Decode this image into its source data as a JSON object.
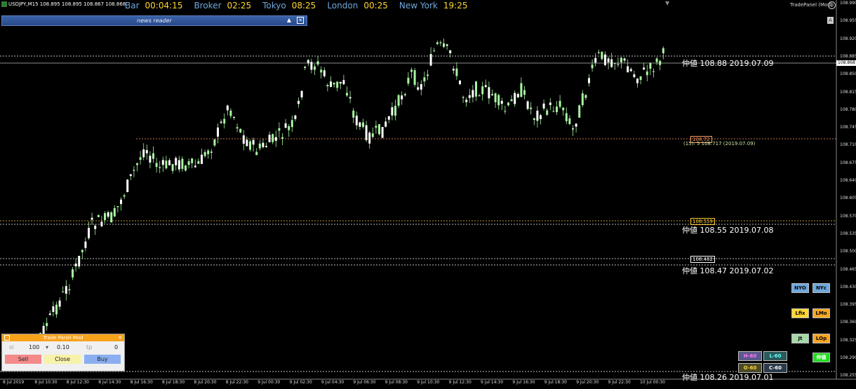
{
  "header": {
    "symbol_info": "USDJPY,M15  108.895 108.895 108.867 108.868",
    "sessions": [
      {
        "name": "Bar",
        "time": "00:04:15"
      },
      {
        "name": "Broker",
        "time": "02:25"
      },
      {
        "name": "Tokyo",
        "time": "08:25"
      },
      {
        "name": "London",
        "time": "00:25"
      },
      {
        "name": "New York",
        "time": "19:25"
      }
    ],
    "trade_panel_name": "TradePanel (Mod)",
    "a_label": "A"
  },
  "news_reader": {
    "title": "news reader",
    "collapse": "▲",
    "close": "✕"
  },
  "price_axis": {
    "labels": [
      "108.990",
      "108.955",
      "108.920",
      "108.885",
      "108.850",
      "108.815",
      "108.780",
      "108.745",
      "108.710",
      "108.675",
      "108.640",
      "108.605",
      "108.570",
      "108.535",
      "108.500",
      "108.465",
      "108.430",
      "108.395",
      "108.360",
      "108.325",
      "108.290",
      "108.255"
    ],
    "current_price": "108.868"
  },
  "time_axis": {
    "labels": [
      "8 Jul 2019",
      "8 Jul 10:30",
      "8 Jul 12:30",
      "8 Jul 14:30",
      "8 Jul 16:30",
      "8 Jul 18:30",
      "8 Jul 20:30",
      "8 Jul 22:30",
      "9 Jul 00:30",
      "9 Jul 02:30",
      "9 Jul 04:30",
      "9 Jul 06:30",
      "9 Jul 08:30",
      "9 Jul 10:30",
      "9 Jul 12:30",
      "9 Jul 14:30",
      "9 Jul 16:30",
      "9 Jul 18:30",
      "9 Jul 20:30",
      "9 Jul 22:30",
      "10 Jul 00:30"
    ]
  },
  "levels": [
    {
      "text": "仲値 108.88 2019.07.09"
    },
    {
      "text": "仲値 108.55 2019.07.08"
    },
    {
      "text": "仲値 108.47 2019.07.02"
    },
    {
      "text": "仲値 108.26 2019.07.01"
    }
  ],
  "level_tags": [
    {
      "text": "108.72",
      "color": "#ff9966"
    },
    {
      "text": "108.559",
      "color": "#ffcc33"
    },
    {
      "text": "108.482",
      "color": "#ffffff"
    }
  ],
  "extra_text": "(15): 5 108.717 (2019.07.09)",
  "panel_buttons": [
    {
      "label": "NYO",
      "bg": "#6fa8dc",
      "fg": "#000"
    },
    {
      "label": "NYc",
      "bg": "#6fa8dc",
      "fg": "#000"
    },
    {
      "label": "Lfix",
      "bg": "#ffd633",
      "fg": "#000"
    },
    {
      "label": "LMo",
      "bg": "#f6a623",
      "fg": "#000"
    },
    {
      "label": "Jt",
      "bg": "#a8d8a8",
      "fg": "#000"
    },
    {
      "label": "LOp",
      "bg": "#f6a623",
      "fg": "#000"
    },
    {
      "label": "H-60",
      "bg": "#5a5a8a",
      "fg": "#ff77ff"
    },
    {
      "label": "L-60",
      "bg": "#2a5a5a",
      "fg": "#6ff"
    },
    {
      "label": "O-60",
      "bg": "#4a4a2a",
      "fg": "#ffd633"
    },
    {
      "label": "C-60",
      "bg": "#2a3a4a",
      "fg": "#fff"
    },
    {
      "label": "仲値",
      "bg": "#22dd22",
      "fg": "#fff"
    }
  ],
  "trade_panel": {
    "title": "Trade Panel Mod",
    "sl_label": "sl",
    "sl_value": "100",
    "lot_arrow": "▾",
    "lot_value": "0.10",
    "tp_label": "tp",
    "tp_value": "0",
    "sell": "Sell",
    "close": "Close",
    "buy": "Buy",
    "colors": {
      "sell": "#f48a8a",
      "close": "#f7f2a8",
      "buy": "#8aaef0"
    }
  },
  "chart_colors": {
    "bull": "#a8f5a0",
    "bear": "#ffffff",
    "wick": "#a8f5a0",
    "grid": "#ffffff"
  }
}
